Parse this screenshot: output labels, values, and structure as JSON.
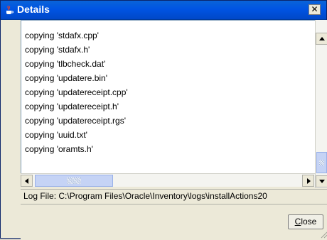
{
  "window": {
    "title": "Details",
    "title_icon": "java-coffee-cup-icon",
    "close_glyph": "✕",
    "colors": {
      "titlebar": "#0054e3",
      "face": "#ece9d8",
      "accent": "#c5d3f5"
    }
  },
  "log": {
    "lines": [
      "copying 'stdafx.cpp'",
      "copying 'stdafx.h'",
      "copying 'tlbcheck.dat'",
      "copying 'updatere.bin'",
      "copying 'updatereceipt.cpp'",
      "copying 'updatereceipt.h'",
      "copying 'updatereceipt.rgs'",
      "copying 'uuid.txt'",
      "copying 'oramts.h'"
    ]
  },
  "logfile": {
    "text": "Log File: C:\\Program Files\\Oracle\\Inventory\\logs\\installActions20"
  },
  "buttons": {
    "close_mnemonic": "C",
    "close_rest": "lose"
  }
}
